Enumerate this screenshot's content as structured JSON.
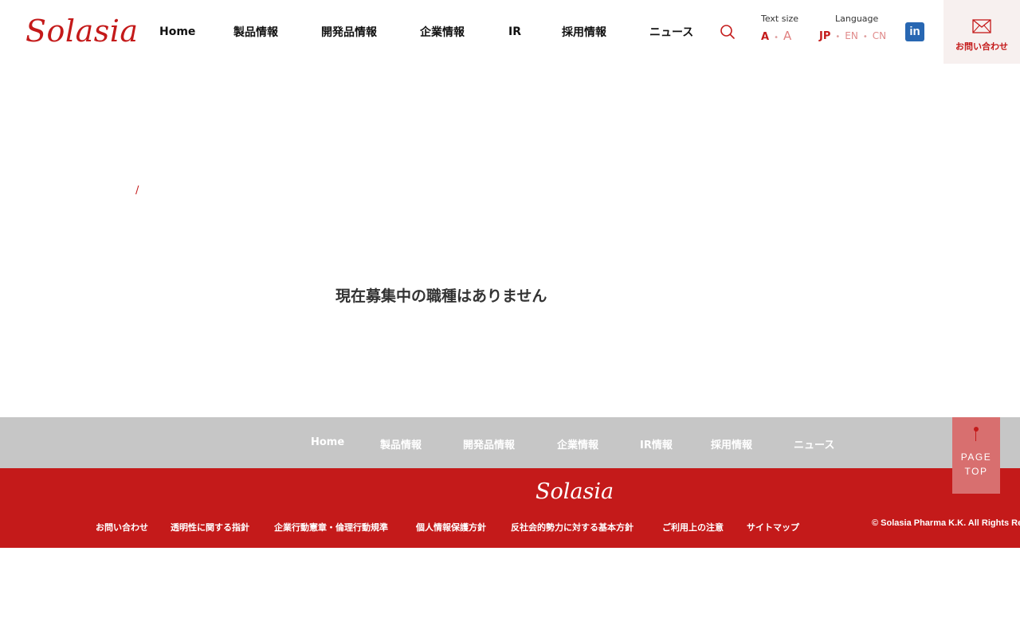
{
  "header": {
    "logo": "Solasia",
    "nav": [
      "Home",
      "製品情報",
      "開発品情報",
      "企業情報",
      "IR",
      "採用情報",
      "ニュース"
    ],
    "text_size": {
      "label": "Text size",
      "small": "A",
      "large": "A"
    },
    "language": {
      "label": "Language",
      "options": [
        "JP",
        "EN",
        "CN"
      ]
    },
    "linkedin": "in",
    "contact": "お問い合わせ",
    "accent_color": "#c41a1a"
  },
  "main": {
    "breadcrumb_separator": "/",
    "message": "現在募集中の職種はありません"
  },
  "footer": {
    "nav": [
      "Home",
      "製品情報",
      "開発品情報",
      "企業情報",
      "IR情報",
      "採用情報",
      "ニュース"
    ],
    "page_top": "PAGE TOP",
    "logo": "Solasia",
    "links": [
      "お問い合わせ",
      "透明性に関する指針",
      "企業行動憲章・倫理行動規準",
      "個人情報保護方針",
      "反社会的勢力に対する基本方針",
      "ご利用上の注意",
      "サイトマップ"
    ],
    "copyright": "© Solasia Pharma K.K. All Rights Re"
  }
}
